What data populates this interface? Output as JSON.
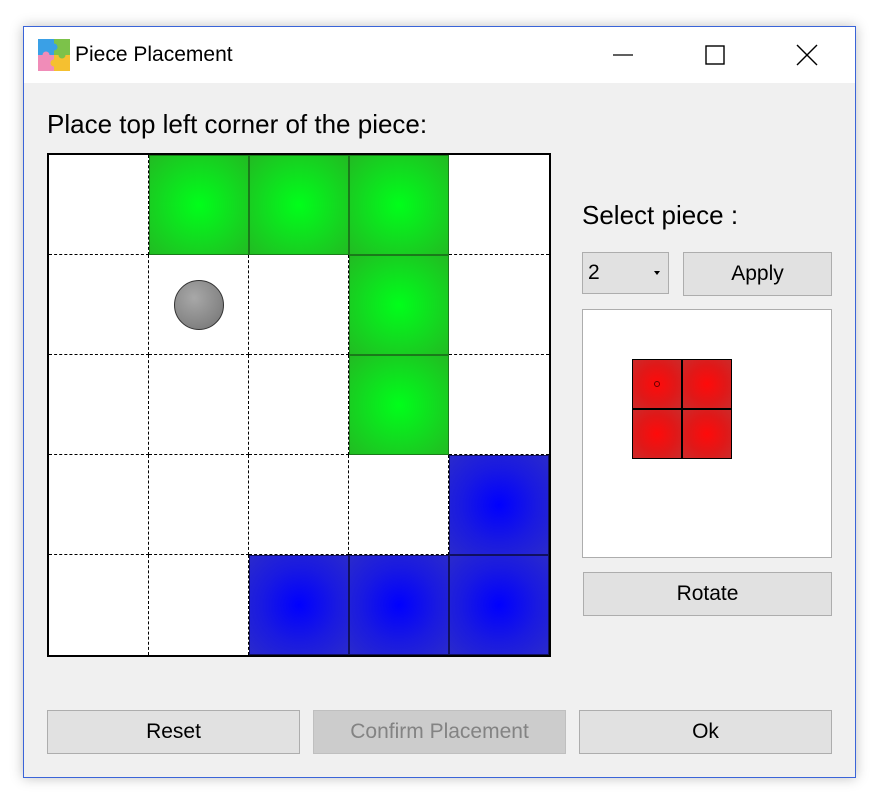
{
  "window": {
    "title": "Piece Placement",
    "controls": [
      "minimize-icon",
      "maximize-icon",
      "close-icon"
    ]
  },
  "prompt": "Place top left corner of the piece:",
  "board": {
    "rows": 5,
    "cols": 5,
    "cells": [
      [
        "empty",
        "green",
        "green",
        "green",
        "empty"
      ],
      [
        "empty",
        "empty",
        "empty",
        "green",
        "empty"
      ],
      [
        "empty",
        "empty",
        "empty",
        "green",
        "empty"
      ],
      [
        "empty",
        "empty",
        "empty",
        "empty",
        "blue"
      ],
      [
        "empty",
        "empty",
        "blue",
        "blue",
        "blue"
      ]
    ],
    "ball": {
      "row": 1,
      "col": 1
    },
    "colors": {
      "green": "#13d920",
      "blue": "#1a1ae0",
      "ball": "#888888"
    }
  },
  "piece_selector": {
    "label": "Select piece :",
    "selected": "2",
    "apply_label": "Apply",
    "rotate_label": "Rotate",
    "preview": {
      "cells": [
        [
          1,
          1
        ],
        [
          1,
          1
        ]
      ],
      "color": "#e01818",
      "marker": {
        "row": 0,
        "col": 0
      }
    }
  },
  "footer": {
    "reset_label": "Reset",
    "confirm_label": "Confirm Placement",
    "confirm_disabled": true,
    "ok_label": "Ok"
  }
}
